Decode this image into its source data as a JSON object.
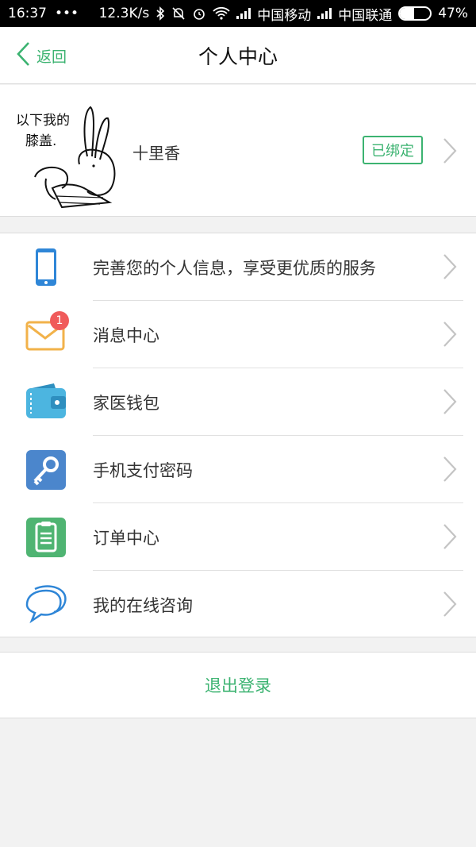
{
  "status_bar": {
    "time": "16:37",
    "dots": "•••",
    "speed": "12.3K/s",
    "carrier1": "中国移动",
    "carrier2": "中国联通",
    "battery": "47%",
    "battery_level": 0.47
  },
  "header": {
    "back_label": "返回",
    "title": "个人中心"
  },
  "profile": {
    "nickname": "十里香",
    "bound_label": "已绑定",
    "avatar_text_line1": "以下我的",
    "avatar_text_line2": "膝盖."
  },
  "menu": {
    "items": [
      {
        "label": "完善您的个人信息，享受更优质的服务",
        "icon": "phone-icon"
      },
      {
        "label": "消息中心",
        "icon": "mail-icon",
        "badge": "1"
      },
      {
        "label": "家医钱包",
        "icon": "wallet-icon"
      },
      {
        "label": "手机支付密码",
        "icon": "key-icon"
      },
      {
        "label": "订单中心",
        "icon": "clipboard-icon"
      },
      {
        "label": "我的在线咨询",
        "icon": "chat-bubbles-icon"
      }
    ]
  },
  "logout_label": "退出登录",
  "colors": {
    "accent": "#3cb371",
    "badge": "#f05b5b"
  }
}
